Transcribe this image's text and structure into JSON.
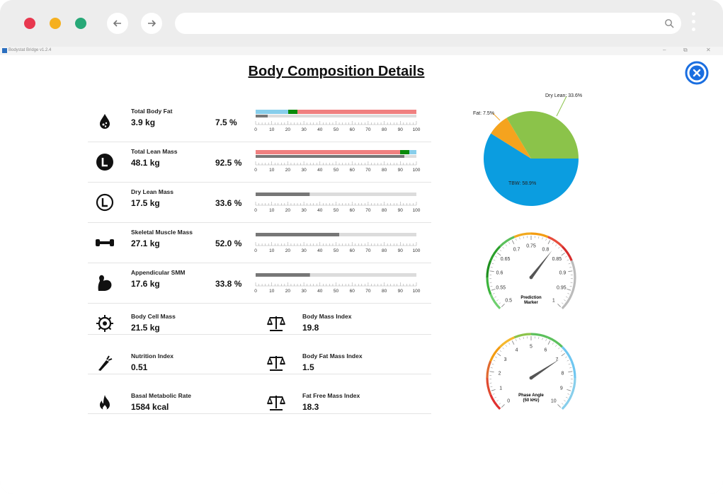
{
  "app": {
    "title": "Bodystat Bridge v1.2.4",
    "heading": "Body Composition Details"
  },
  "window_controls": [
    "–",
    "⧉",
    "✕"
  ],
  "colors": {
    "fat": "#f08080",
    "fat_light": "#87ceeb",
    "green": "#0a8a0a",
    "gray": "#777777",
    "pie_tbw": "#0b9de0",
    "pie_fat": "#f5a31e",
    "pie_dry": "#8bc34a",
    "close": "#1a6ee0"
  },
  "scale_ticks": [
    "0",
    "10",
    "20",
    "30",
    "40",
    "50",
    "60",
    "70",
    "80",
    "90",
    "100"
  ],
  "metrics": [
    {
      "label": "Total Body Fat",
      "value": "3.9 kg",
      "percent": "7.5 %",
      "icon": "fat-drop-icon",
      "pct_value": 7.5
    },
    {
      "label": "Total Lean Mass",
      "value": "48.1 kg",
      "percent": "92.5 %",
      "icon": "lean-mass-icon",
      "pct_value": 92.5
    },
    {
      "label": "Dry Lean Mass",
      "value": "17.5 kg",
      "percent": "33.6 %",
      "icon": "dry-lean-icon",
      "pct_value": 33.6
    },
    {
      "label": "Skeletal Muscle Mass",
      "value": "27.1 kg",
      "percent": "52.0 %",
      "icon": "dumbbell-icon",
      "pct_value": 52.0
    },
    {
      "label": "Appendicular SMM",
      "value": "17.6 kg",
      "percent": "33.8 %",
      "icon": "bicep-icon",
      "pct_value": 33.8
    }
  ],
  "pairs": [
    {
      "left": {
        "label": "Body Cell Mass",
        "value": "21.5 kg",
        "icon": "cell-icon"
      },
      "right": {
        "label": "Body Mass Index",
        "value": "19.8",
        "icon": "scale-icon"
      }
    },
    {
      "left": {
        "label": "Nutrition Index",
        "value": "0.51",
        "icon": "nutrition-icon"
      },
      "right": {
        "label": "Body Fat Mass Index",
        "value": "1.5",
        "icon": "scale-icon"
      }
    },
    {
      "left": {
        "label": "Basal Metabolic Rate",
        "value": "1584 kcal",
        "icon": "flame-icon"
      },
      "right": {
        "label": "Fat Free Mass Index",
        "value": "18.3",
        "icon": "scale-icon"
      }
    }
  ],
  "pie": {
    "labels": {
      "tbw": "TBW: 58.9%",
      "fat": "Fat: 7.5%",
      "dry": "Dry Lean: 33.6%"
    },
    "values": {
      "tbw": 58.9,
      "fat": 7.5,
      "dry": 33.6
    }
  },
  "prediction_marker": {
    "title": "Prediction",
    "subtitle": "Marker",
    "ticks": [
      "0.5",
      "0.55",
      "0.6",
      "0.65",
      "0.7",
      "0.75",
      "0.8",
      "0.85",
      "0.9",
      "0.95",
      "1"
    ],
    "value": 0.82
  },
  "phase_angle": {
    "title": "Phase Angle",
    "subtitle": "(50 kHz)",
    "ticks": [
      "0",
      "1",
      "2",
      "3",
      "4",
      "5",
      "6",
      "7",
      "8",
      "9",
      "10"
    ],
    "value": 7.1
  }
}
